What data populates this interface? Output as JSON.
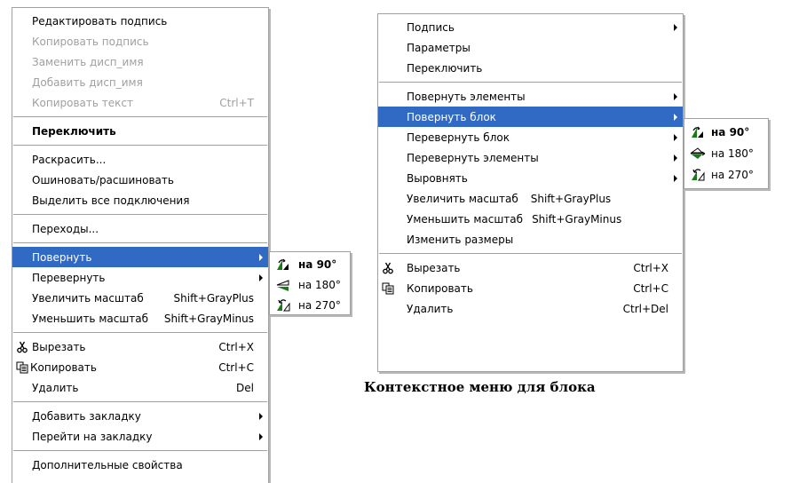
{
  "menu_left": {
    "items": [
      {
        "label": "Редактировать подпись"
      },
      {
        "label": "Копировать подпись"
      },
      {
        "label": "Заменить дисп_имя"
      },
      {
        "label": "Добавить дисп_имя"
      },
      {
        "label": "Копировать текст",
        "shortcut": "Ctrl+T"
      },
      {
        "label": "Переключить"
      },
      {
        "label": "Раскрасить..."
      },
      {
        "label": "Ошиновать/расшиновать"
      },
      {
        "label": "Выделить все подключения"
      },
      {
        "label": "Переходы..."
      },
      {
        "label": "Повернуть"
      },
      {
        "label": "Перевернуть"
      },
      {
        "label": "Увеличить масштаб",
        "shortcut": "Shift+GrayPlus"
      },
      {
        "label": "Уменьшить масштаб",
        "shortcut": "Shift+GrayMinus"
      },
      {
        "label": "Вырезать",
        "shortcut": "Ctrl+X",
        "icon": "scissors-icon"
      },
      {
        "label": "Копировать",
        "shortcut": "Ctrl+C",
        "icon": "copy-icon"
      },
      {
        "label": "Удалить",
        "shortcut": "Del"
      },
      {
        "label": "Добавить закладку"
      },
      {
        "label": "Перейти на закладку"
      },
      {
        "label": "Дополнительные свойства"
      }
    ],
    "submenu": [
      {
        "label": "на 90°",
        "icon": "rotate-90-icon"
      },
      {
        "label": "на 180°",
        "icon": "rotate-180-icon"
      },
      {
        "label": "на 270°",
        "icon": "rotate-270-icon"
      }
    ]
  },
  "menu_right": {
    "items": [
      {
        "label": "Подпись"
      },
      {
        "label": "Параметры"
      },
      {
        "label": "Переключить"
      },
      {
        "label": "Повернуть элементы"
      },
      {
        "label": "Повернуть блок"
      },
      {
        "label": "Перевернуть блок"
      },
      {
        "label": "Перевернуть элементы"
      },
      {
        "label": "Выровнять"
      },
      {
        "label": "Увеличить масштаб",
        "shortcut": "Shift+GrayPlus"
      },
      {
        "label": "Уменьшить масштаб",
        "shortcut": "Shift+GrayMinus"
      },
      {
        "label": "Изменить размеры"
      },
      {
        "label": "Вырезать",
        "shortcut": "Ctrl+X",
        "icon": "scissors-icon"
      },
      {
        "label": "Копировать",
        "shortcut": "Ctrl+C",
        "icon": "copy-icon"
      },
      {
        "label": "Удалить",
        "shortcut": "Ctrl+Del"
      }
    ],
    "submenu": [
      {
        "label": "на 90°",
        "icon": "rotate-90-icon"
      },
      {
        "label": "на 180°",
        "icon": "flip-180-icon"
      },
      {
        "label": "на 270°",
        "icon": "rotate-270-icon"
      }
    ]
  },
  "caption": "Контекстное меню для блока",
  "colors": {
    "highlight": "#316ac5",
    "disabled": "#a0a0a0",
    "icon_green": "#1a7a1a"
  }
}
